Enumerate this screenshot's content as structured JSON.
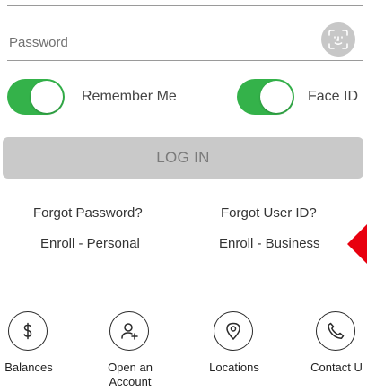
{
  "username_field": {},
  "password_field": {
    "placeholder": "Password",
    "face_id_icon": "face-scan-icon"
  },
  "toggles": {
    "remember_me": {
      "label": "Remember Me",
      "on": true
    },
    "face_id": {
      "label": "Face ID",
      "on": true
    }
  },
  "login_button": {
    "label": "LOG IN"
  },
  "links": {
    "forgot_password": "Forgot Password?",
    "forgot_user_id": "Forgot User ID?",
    "enroll_personal": "Enroll - Personal",
    "enroll_business": "Enroll - Business"
  },
  "quick_actions": [
    {
      "label": "Balances",
      "icon": "dollar-icon"
    },
    {
      "label": "Open an\nAccount",
      "icon": "add-user-icon"
    },
    {
      "label": "Locations",
      "icon": "location-pin-icon"
    },
    {
      "label": "Contact U",
      "icon": "phone-icon"
    }
  ],
  "colors": {
    "toggle_on": "#34b24a",
    "login_disabled_bg": "#c9c9c9",
    "arrow": "#e8000f"
  }
}
